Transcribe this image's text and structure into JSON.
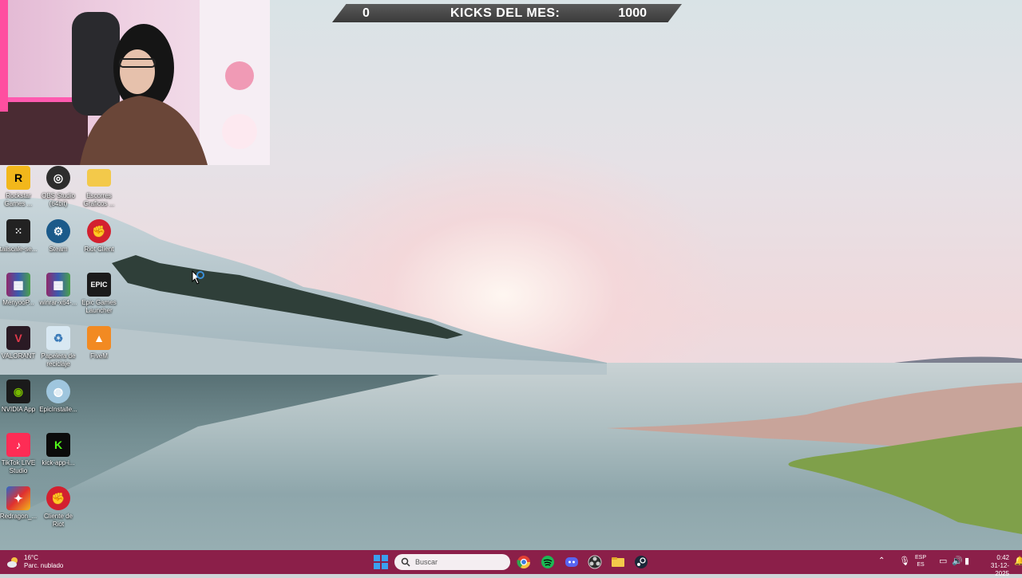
{
  "scorebar": {
    "left_value": "0",
    "title": "KICKS DEL MES:",
    "right_value": "1000"
  },
  "desktop_icons": [
    {
      "label": "Rockstar Games ...",
      "icon": "rockstar-icon",
      "color": "#f2b71b"
    },
    {
      "label": "OBS Studio (64bit)",
      "icon": "obs-icon",
      "color": "#2d2d2d"
    },
    {
      "label": "Escorres Graficos ...",
      "icon": "folder-icon",
      "color": "#f3c94a"
    },
    {
      "label": "tailscale-se...",
      "icon": "tailscale-icon",
      "color": "#222222"
    },
    {
      "label": "Steam",
      "icon": "steam-icon",
      "color": "#1b5a8a"
    },
    {
      "label": "Riot Client",
      "icon": "riot-icon",
      "color": "#d3202f"
    },
    {
      "label": "MenyooP...",
      "icon": "winrar-icon",
      "color": "#8e2a6c"
    },
    {
      "label": "winrar-x64-...",
      "icon": "winrar-icon",
      "color": "#8e2a6c"
    },
    {
      "label": "Epic Games Launcher",
      "icon": "epic-icon",
      "color": "#1b1b1b"
    },
    {
      "label": "VALORANT",
      "icon": "valorant-icon",
      "color": "#e0394b"
    },
    {
      "label": "Papelera de reciclaje",
      "icon": "recycle-bin-icon",
      "color": "#d8e8f2"
    },
    {
      "label": "FiveM",
      "icon": "fivem-icon",
      "color": "#f28a22"
    },
    {
      "label": "NVIDIA App",
      "icon": "nvidia-icon",
      "color": "#76b900"
    },
    {
      "label": "EpicInstalle...",
      "icon": "disc-icon",
      "color": "#9fc6de"
    },
    {
      "label": "TikTok LIVE Studio",
      "icon": "tiktok-icon",
      "color": "#fe2c55"
    },
    {
      "label": "kick-app-i...",
      "icon": "kick-icon",
      "color": "#0b0b0b"
    },
    {
      "label": "Redragon_...",
      "icon": "redragon-icon",
      "color": "#2a6acb"
    },
    {
      "label": "Cliente de Riot",
      "icon": "riot-icon",
      "color": "#d3202f"
    }
  ],
  "taskbar": {
    "weather_temp": "16°C",
    "weather_desc": "Parc. nublado",
    "search_placeholder": "Buscar",
    "lang_top": "ESP",
    "lang_bottom": "ES",
    "time": "0:42",
    "date": "31-12-2025"
  },
  "colors": {
    "taskbar": "#8b1f49",
    "scorebar": "#3a3a3a"
  }
}
